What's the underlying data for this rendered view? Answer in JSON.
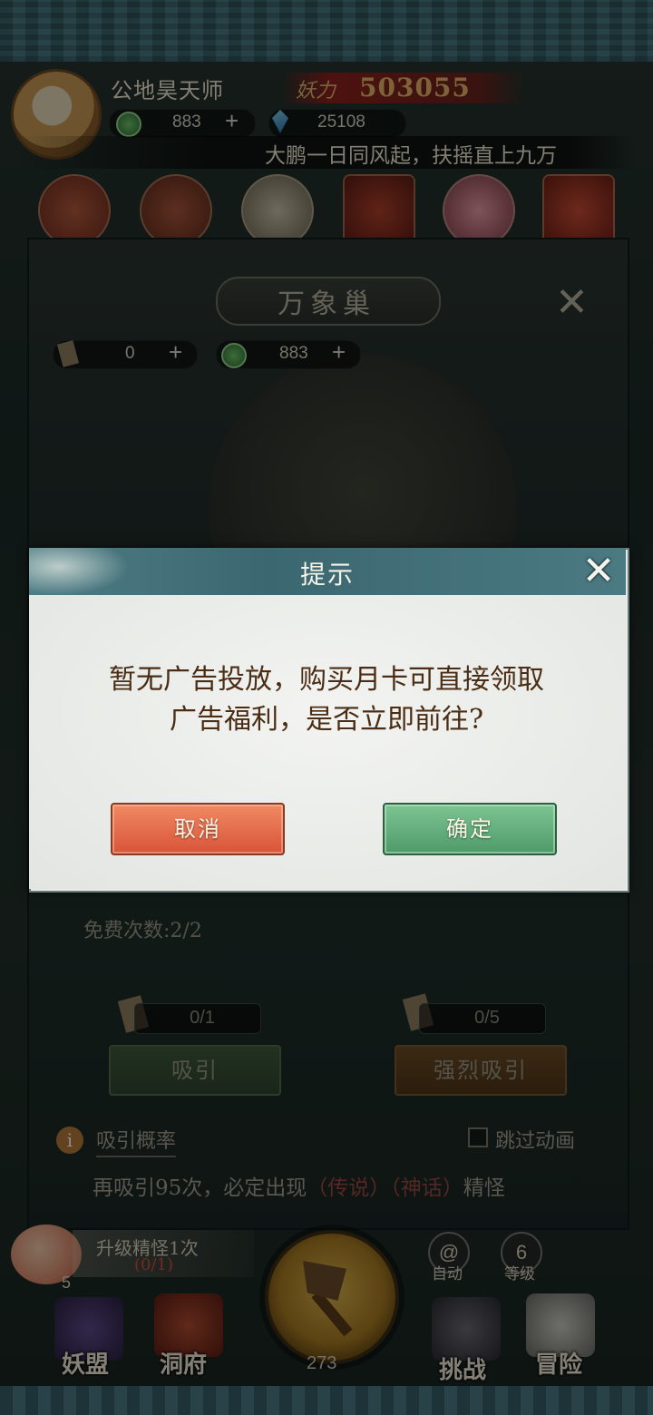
{
  "header": {
    "player_name": "公地昊天师",
    "power_label": "妖力",
    "power_value": "503055",
    "jade_amount": "883",
    "crystal_amount": "25108",
    "marquee": "大鹏一日同风起，扶摇直上九万",
    "plus": "+"
  },
  "panel": {
    "title": "万象巢",
    "close": "✕",
    "scroll_amount": "0",
    "jade_amount": "883",
    "free_count": "免费次数:2/2",
    "attract_count": "0/1",
    "strong_count": "0/5",
    "attract_label": "吸引",
    "strong_attract_label": "强烈吸引",
    "info_icon": "i",
    "probability_link": "吸引概率",
    "skip_animation": "跳过动画",
    "pity_prefix": "再吸引95次，必定出现",
    "pity_legend": "（传说）",
    "pity_myth": "（神话）",
    "pity_suffix": "精怪"
  },
  "bottom": {
    "upgrade_label": "升级精怪1次",
    "upgrade_progress": "(0/1)",
    "peach_level": "5",
    "axe_count": "273",
    "auto_label": "自动",
    "level_value": "6",
    "level_label": "等级",
    "nav": [
      "妖盟",
      "洞府",
      "挑战",
      "冒险"
    ]
  },
  "dialog": {
    "title": "提示",
    "close": "✕",
    "message_line1": "暂无广告投放，购买月卡可直接领取",
    "message_line2": "广告福利，是否立即前往?",
    "cancel": "取消",
    "confirm": "确定"
  },
  "colors": {
    "cancel": "#d9543a",
    "confirm": "#4f9a6a",
    "dialog_header": "#3b6770",
    "message_text": "#4a2d14"
  }
}
